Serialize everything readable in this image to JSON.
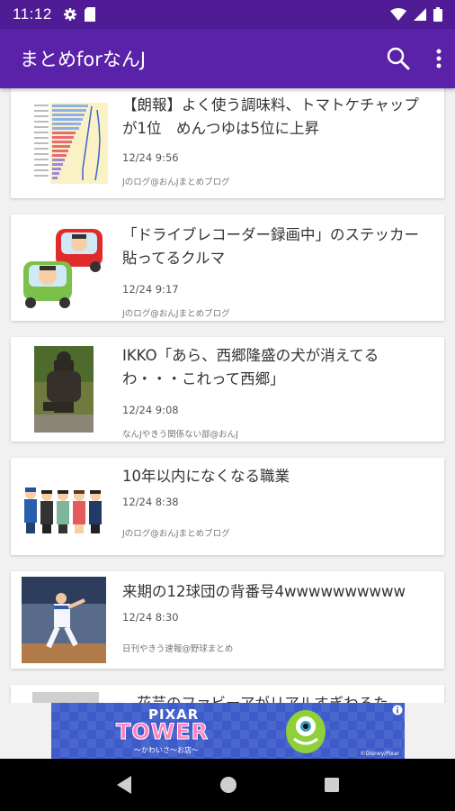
{
  "status": {
    "time": "11:12"
  },
  "app": {
    "title": "まとめforなんJ"
  },
  "articles": [
    {
      "title": "【朗報】よく使う調味料、トマトケチャップが1位　めんつゆは5位に上昇",
      "time": "12/24 9:56",
      "source": "Jのログ@おんJまとめブログ"
    },
    {
      "title": "「ドライブレコーダー録画中」のステッカー貼ってるクルマ",
      "time": "12/24 9:17",
      "source": "Jのログ@おんJまとめブログ"
    },
    {
      "title": "IKKO「あら、西郷隆盛の犬が消えてるわ・・・これって西郷」",
      "time": "12/24 9:08",
      "source": "なんJやきう関係ない部@おんJ"
    },
    {
      "title": "10年以内になくなる職業",
      "time": "12/24 8:38",
      "source": "Jのログ@おんJまとめブログ"
    },
    {
      "title": "来期の12球団の背番号4wwwwwwwwww",
      "time": "12/24 8:30",
      "source": "日刊やきう速報@野球まとめ"
    },
    {
      "title": "花芸のファビーアがリアルすぎわろた",
      "time": "",
      "source": ""
    }
  ],
  "ad": {
    "line1": "PIXAR",
    "line2": "TOWER",
    "sub": "〜かわいさ〜お店〜",
    "copyright": "©Disney/Pixar"
  },
  "icons": [
    "gear-icon",
    "sd-card-icon",
    "wifi-icon",
    "signal-icon",
    "battery-icon",
    "search-icon",
    "overflow-menu-icon",
    "back-icon",
    "home-icon",
    "recents-icon",
    "ad-info-icon"
  ]
}
